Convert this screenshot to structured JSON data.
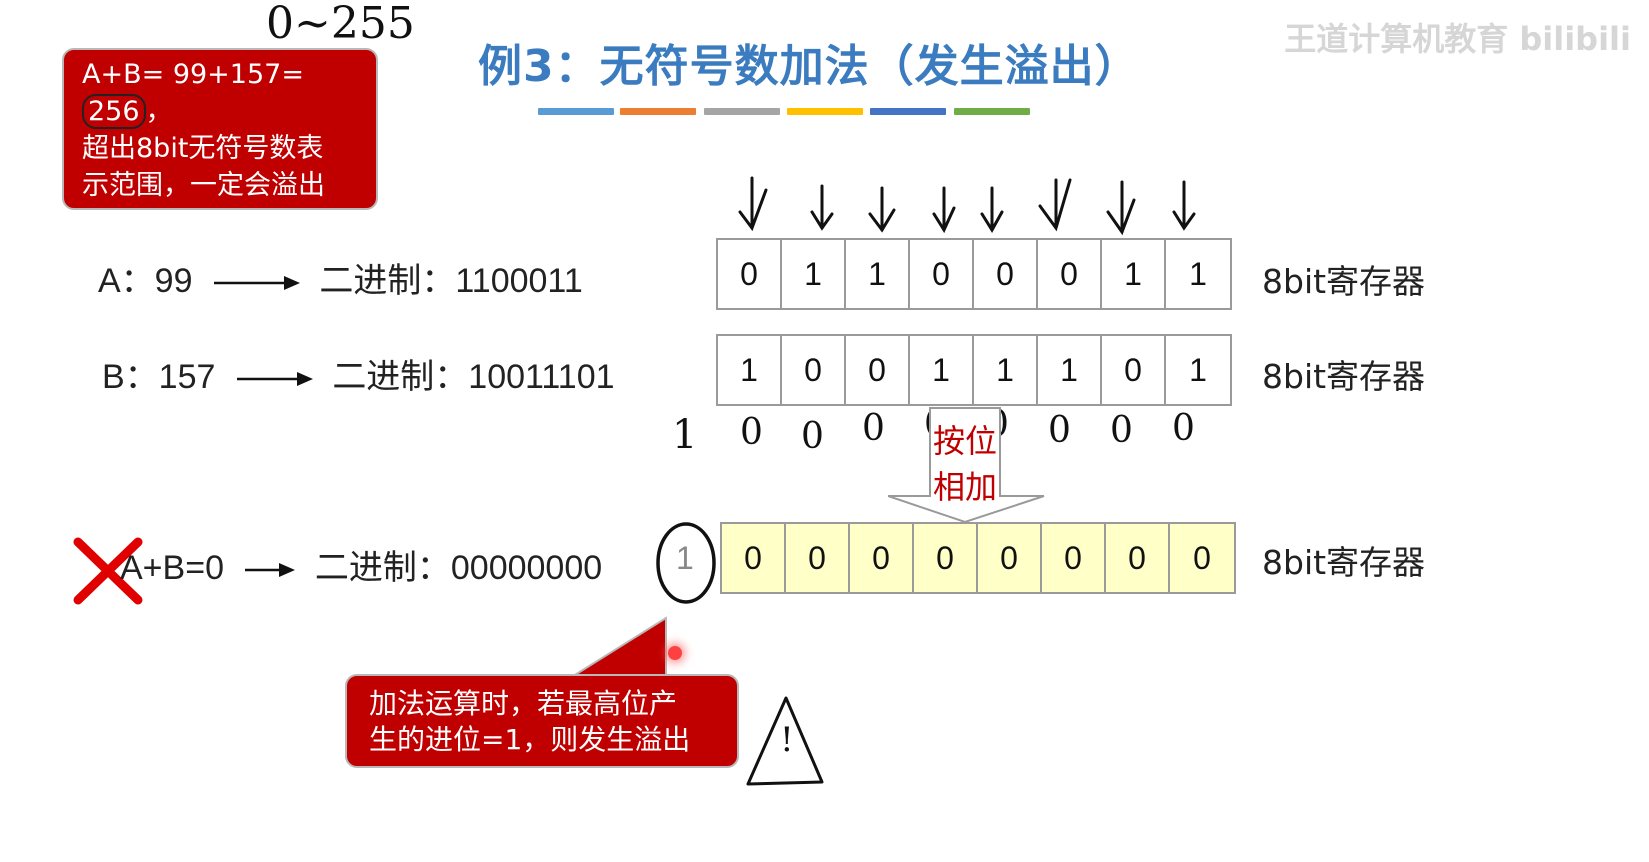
{
  "title": "例3：无符号数加法（发生溢出）",
  "title_bar_colors": [
    "#5b9bd5",
    "#ed7d31",
    "#a5a5a5",
    "#ffc000",
    "#4472c4",
    "#70ad47"
  ],
  "watermark": "王道计算机教育 bilibili",
  "annotation_range": "0~255",
  "callout_top": {
    "line1_prefix": "A+B= 99+157= ",
    "line1_highlight": "256",
    "line1_suffix": "，",
    "line2": "超出8bit无符号数表",
    "line3": "示范围，一定会溢出"
  },
  "row_a": {
    "label": "A：99",
    "binary_label": "二进制：1100011",
    "bits": [
      "0",
      "1",
      "1",
      "0",
      "0",
      "0",
      "1",
      "1"
    ],
    "reg_label": "8bit寄存器"
  },
  "row_b": {
    "label": "B：157",
    "binary_label": "二进制：10011101",
    "bits": [
      "1",
      "0",
      "0",
      "1",
      "1",
      "1",
      "0",
      "1"
    ],
    "reg_label": "8bit寄存器"
  },
  "carry_row": {
    "carry_out": "1",
    "carries": [
      "0",
      "0",
      "0",
      "0",
      "0",
      "0",
      "0",
      "0"
    ]
  },
  "add_label_line1": "按位",
  "add_label_line2": "相加",
  "row_result": {
    "label": "A+B=0",
    "binary_label": "二进制：00000000",
    "overflow_bit": "1",
    "bits": [
      "0",
      "0",
      "0",
      "0",
      "0",
      "0",
      "0",
      "0"
    ],
    "reg_label": "8bit寄存器"
  },
  "callout_bottom": {
    "line1": "加法运算时，若最高位产",
    "line2": "生的进位=1，则发生溢出"
  },
  "warning_symbol": "!"
}
